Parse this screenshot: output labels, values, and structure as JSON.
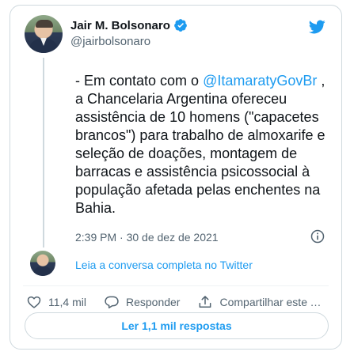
{
  "author": {
    "name": "Jair M. Bolsonaro",
    "handle": "@jairbolsonaro",
    "verified": true
  },
  "tweet": {
    "text_before": "- Em contato com o ",
    "mention": "@ItamaratyGovBr",
    "text_after": " , a Chancelaria Argentina ofereceu assistência de 10 homens (\"capacetes brancos\") para trabalho de almoxarife e seleção de doações, montagem de barracas e assistência psicossocial à população afetada pelas enchentes na Bahia.",
    "timestamp": "2:39 PM · 30 de dez de 2021"
  },
  "thread": {
    "read_thread_label": "Leia a conversa completa no Twitter"
  },
  "actions": {
    "likes_count": "11,4 mil",
    "reply_label": "Responder",
    "share_label": "Compartilhar este Tweet"
  },
  "footer": {
    "read_replies_label": "Ler 1,1 mil respostas"
  },
  "colors": {
    "accent": "#1d9bf0",
    "text": "#0f1419",
    "muted": "#536471",
    "border": "#cfd9de"
  },
  "icons": [
    "verified-badge-icon",
    "twitter-bird-icon",
    "info-icon",
    "heart-icon",
    "reply-bubble-icon",
    "share-icon"
  ]
}
